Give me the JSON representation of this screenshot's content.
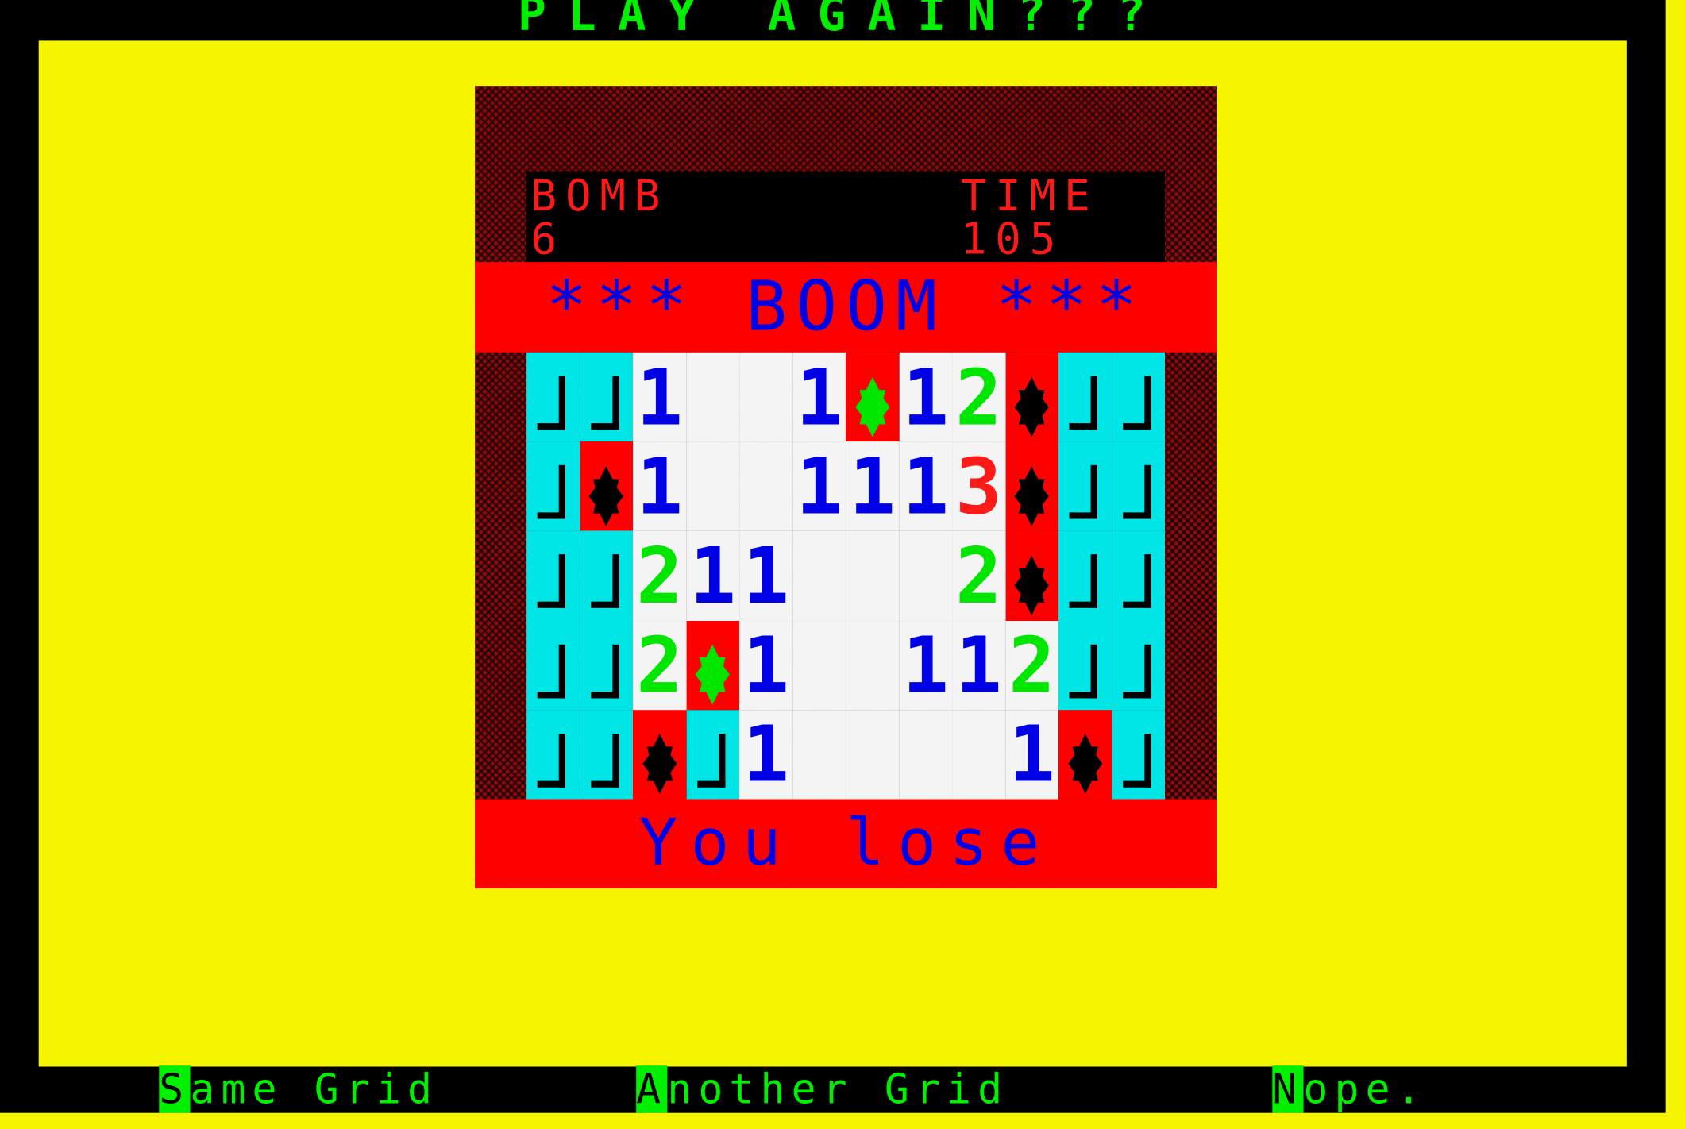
{
  "title": "PLAY   AGAIN???",
  "status": {
    "bomb_label": "BOMB",
    "bomb_value": "6",
    "time_label": "TIME",
    "time_value": "105"
  },
  "banner": "*** BOOM ***",
  "result": "You lose",
  "grid": [
    [
      "H",
      "H",
      "1",
      "",
      "",
      "1",
      "BG",
      "1",
      "2",
      "BB",
      "H",
      "H"
    ],
    [
      "H",
      "BB",
      "1",
      "",
      "",
      "1",
      "1",
      "1",
      "3",
      "BB",
      "H",
      "H"
    ],
    [
      "H",
      "H",
      "2",
      "1",
      "1",
      "",
      "",
      "",
      "2",
      "BB",
      "H",
      "H"
    ],
    [
      "H",
      "H",
      "2",
      "BG",
      "1",
      "",
      "",
      "1",
      "1",
      "2",
      "H",
      "H"
    ],
    [
      "H",
      "H",
      "BB",
      "H",
      "1",
      "",
      "",
      "",
      "",
      "1",
      "BB",
      "H"
    ]
  ],
  "menu": [
    {
      "hotkey": "S",
      "rest": "ame Grid"
    },
    {
      "hotkey": "A",
      "rest": "nother Grid"
    },
    {
      "hotkey": "N",
      "rest": "ope."
    }
  ],
  "colors": {
    "background": "#f5f500",
    "board_frame": "#8a0c0c",
    "banner": "#ff0000",
    "hidden_cell": "#00e6e6",
    "open_cell": "#f4f4f4",
    "menu_text": "#00f000"
  }
}
